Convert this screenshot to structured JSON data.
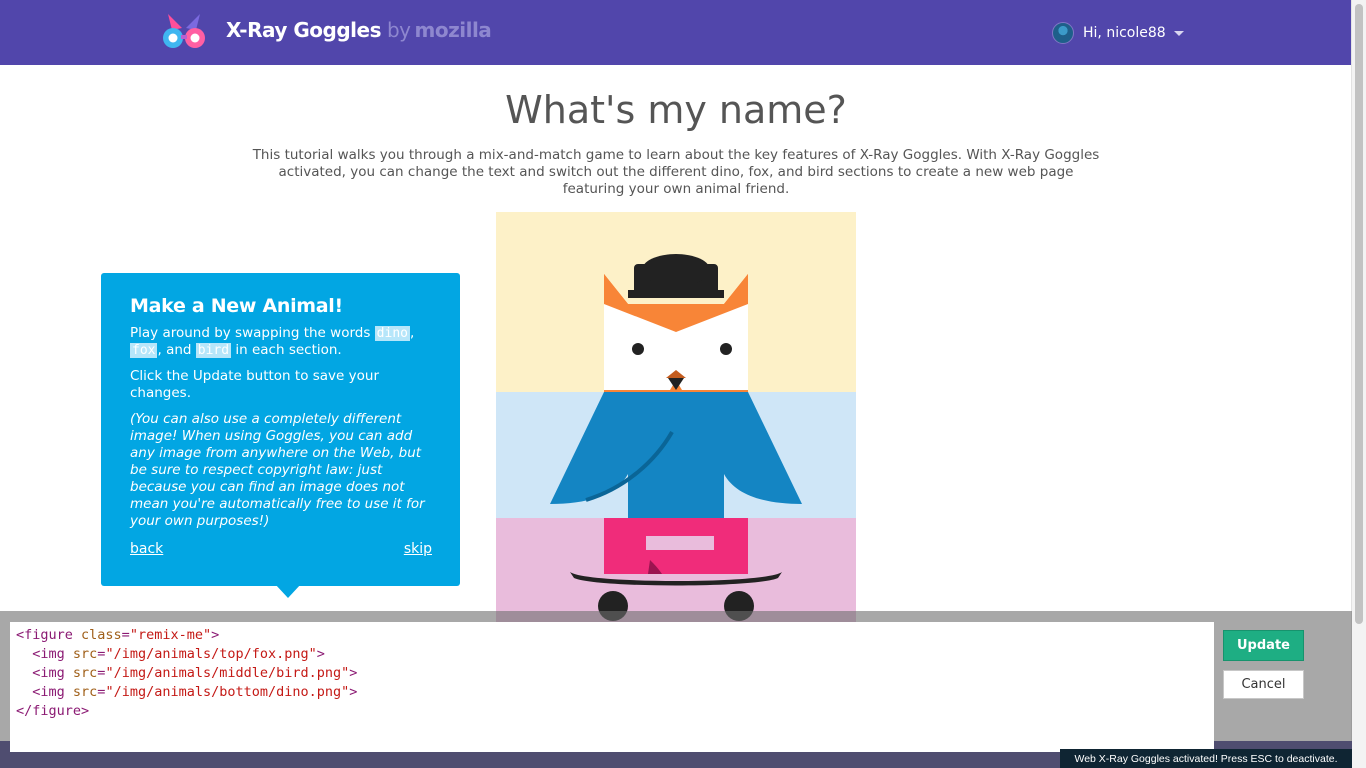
{
  "header": {
    "brand": "X-Ray Goggles",
    "by": "by",
    "vendor": "mozilla",
    "greeting": "Hi, nicole88",
    "background_color": "#5146ab"
  },
  "main": {
    "title": "What's my name?",
    "intro": "This tutorial walks you through a mix-and-match game to learn about the key features of X-Ray Goggles. With X-Ray Goggles activated, you can change the text and switch out the different dino, fox, and bird sections to create a new web page featuring your own animal friend."
  },
  "tutorial": {
    "heading": "Make a New Animal!",
    "line1_a": "Play around by swapping the words ",
    "kw_dino": "dino",
    "comma": ",",
    "kw_fox": "fox",
    "line1_and": ", and ",
    "kw_bird": "bird",
    "line1_b": " in each section.",
    "line2": "Click the Update button to save your changes.",
    "note": "(You can also use a completely different image! When using Goggles, you can add any image from anywhere on the Web, but be sure to respect copyright law: just because you can find an image does not mean you're automatically free to use it for your own purposes!)",
    "back_label": "back",
    "skip_label": "skip",
    "color": "#02a6e3"
  },
  "editor": {
    "l1_open": "<figure ",
    "l1_attr": "class",
    "l1_eq": "=",
    "l1_val": "\"remix-me\"",
    "l1_close": ">",
    "l2_open": "  <img ",
    "l2_attr": "src",
    "l2_eq": "=",
    "l2_val": "\"/img/animals/top/fox.png\"",
    "l2_close": ">",
    "l3_open": "  <img ",
    "l3_attr": "src",
    "l3_eq": "=",
    "l3_val": "\"/img/animals/middle/bird.png\"",
    "l3_close": ">",
    "l4_open": "  <img ",
    "l4_attr": "src",
    "l4_eq": "=",
    "l4_val": "\"/img/animals/bottom/dino.png\"",
    "l4_close": ">",
    "l5": "</figure>",
    "update_label": "Update",
    "cancel_label": "Cancel"
  },
  "status_bar": {
    "message": "Web X-Ray Goggles activated! Press ESC to deactivate."
  },
  "icons": [
    "goggles-logo-icon",
    "user-avatar-icon",
    "chevron-down-icon"
  ]
}
